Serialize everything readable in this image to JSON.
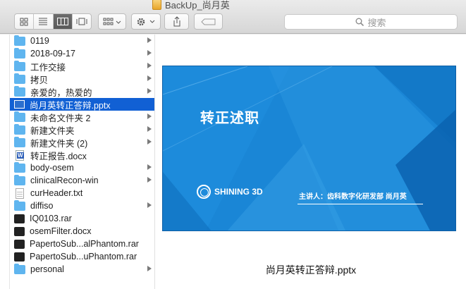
{
  "window": {
    "title": "BackUp_尚月英"
  },
  "toolbar": {
    "search_placeholder": "搜索"
  },
  "column": {
    "items": [
      {
        "label": "0119",
        "type": "folder",
        "arrow": true,
        "selected": false
      },
      {
        "label": "2018-09-17",
        "type": "folder",
        "arrow": true,
        "selected": false
      },
      {
        "label": "工作交接",
        "type": "folder",
        "arrow": true,
        "selected": false
      },
      {
        "label": "拷贝",
        "type": "folder",
        "arrow": true,
        "selected": false
      },
      {
        "label": "亲爱的，热爱的",
        "type": "folder",
        "arrow": true,
        "selected": false
      },
      {
        "label": "尚月英转正答辩.pptx",
        "type": "pptx",
        "arrow": false,
        "selected": true
      },
      {
        "label": "未命名文件夹 2",
        "type": "folder",
        "arrow": true,
        "selected": false
      },
      {
        "label": "新建文件夹",
        "type": "folder",
        "arrow": true,
        "selected": false
      },
      {
        "label": "新建文件夹 (2)",
        "type": "folder",
        "arrow": true,
        "selected": false
      },
      {
        "label": "转正报告.docx",
        "type": "docx",
        "arrow": false,
        "selected": false
      },
      {
        "label": "body-osem",
        "type": "folder",
        "arrow": true,
        "selected": false
      },
      {
        "label": "clinicalRecon-win",
        "type": "folder",
        "arrow": true,
        "selected": false
      },
      {
        "label": "curHeader.txt",
        "type": "txt",
        "arrow": false,
        "selected": false
      },
      {
        "label": "diffiso",
        "type": "folder",
        "arrow": true,
        "selected": false
      },
      {
        "label": "IQ0103.rar",
        "type": "rar",
        "arrow": false,
        "selected": false
      },
      {
        "label": "osemFilter.docx",
        "type": "rar",
        "arrow": false,
        "selected": false
      },
      {
        "label": "PapertoSub...alPhantom.rar",
        "type": "rar",
        "arrow": false,
        "selected": false
      },
      {
        "label": "PapertoSub...uPhantom.rar",
        "type": "rar",
        "arrow": false,
        "selected": false
      },
      {
        "label": "personal",
        "type": "folder",
        "arrow": true,
        "selected": false
      }
    ]
  },
  "preview": {
    "slide_title": "转正述职",
    "logo_text": "SHINING 3D",
    "presenter": "主讲人：齿科数字化研发部 尚月英",
    "filename": "尚月英转正答辩.pptx"
  },
  "colors": {
    "selection": "#1160d4",
    "slide": "#1a86d6",
    "folder": "#5fb5ef"
  }
}
